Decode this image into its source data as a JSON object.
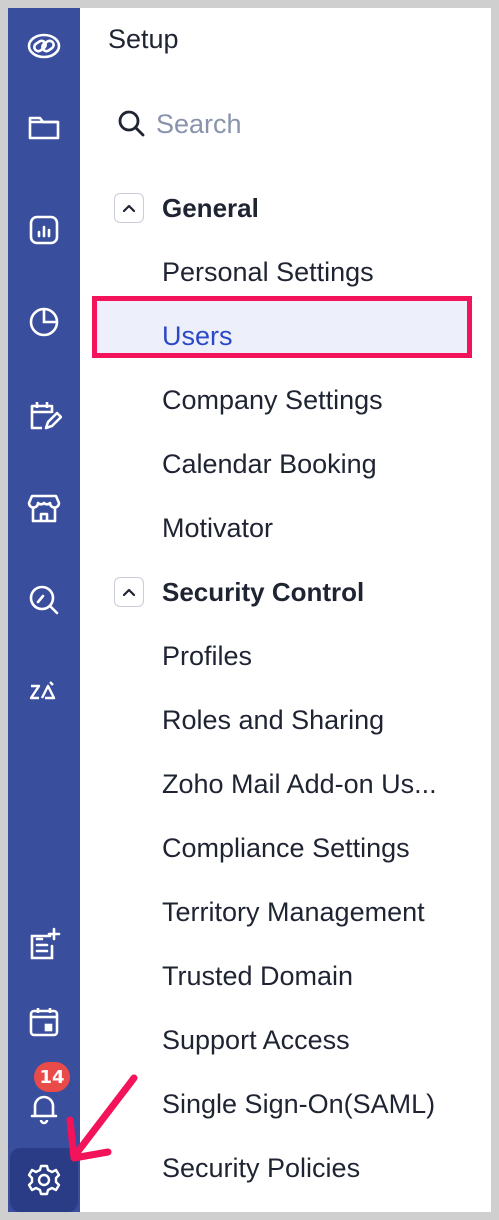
{
  "header": {
    "title": "Setup"
  },
  "search": {
    "placeholder": "Search"
  },
  "sections": [
    {
      "label": "General",
      "items": [
        "Personal Settings",
        "Users",
        "Company Settings",
        "Calendar Booking",
        "Motivator"
      ]
    },
    {
      "label": "Security Control",
      "items": [
        "Profiles",
        "Roles and Sharing",
        "Zoho Mail Add-on Us...",
        "Compliance Settings",
        "Territory Management",
        "Trusted Domain",
        "Support Access",
        "Single Sign-On(SAML)",
        "Security Policies"
      ]
    }
  ],
  "selected_item": "Users",
  "notifications": {
    "count": "14"
  },
  "colors": {
    "rail": "#3a4e9e",
    "selected_text": "#2b49c6",
    "highlight_border": "#f2135a",
    "badge": "#e94a4a"
  },
  "rail_icons": [
    "zoho-logo-icon",
    "folder-icon",
    "reports-icon",
    "analytics-icon",
    "activities-icon",
    "marketplace-icon",
    "search-analytics-icon",
    "zia-icon",
    "add-note-icon",
    "calendar-icon",
    "bell-icon",
    "gear-icon"
  ]
}
